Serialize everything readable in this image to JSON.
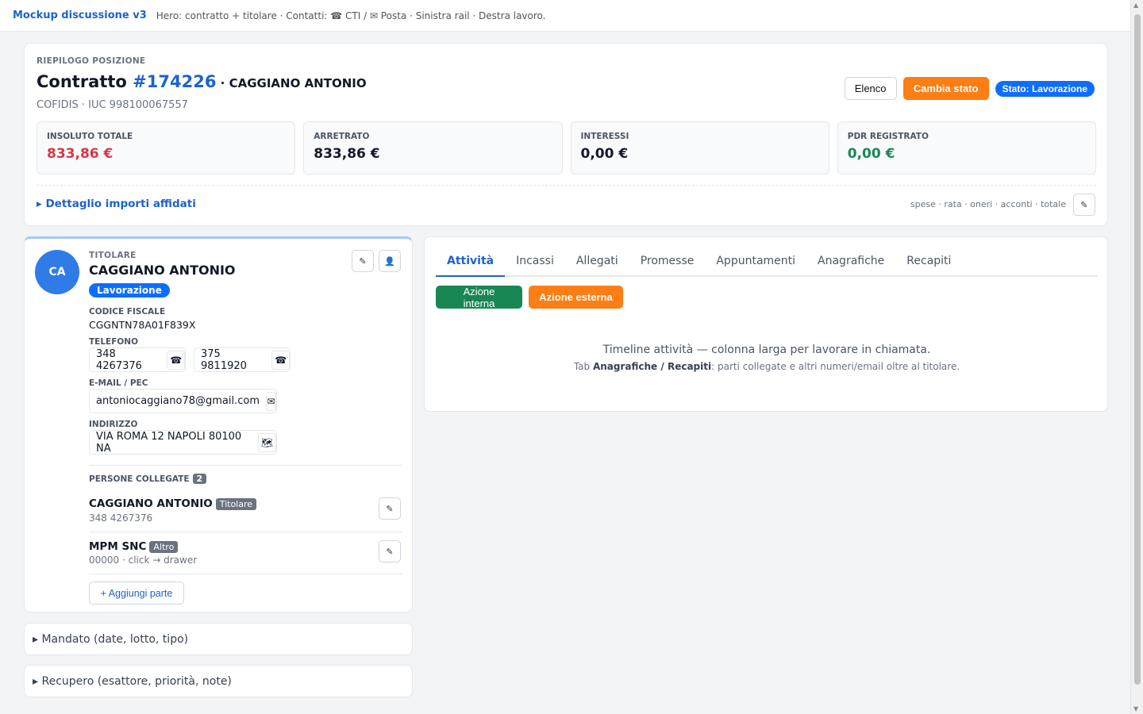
{
  "topbar": {
    "brand": "Mockup discussione v3",
    "subtitle": "Hero: contratto + titolare · Contatti: ☎ CTI / ✉ Posta · Sinistra rail · Destra lavoro."
  },
  "hero": {
    "eyebrow": "RIEPILOGO POSIZIONE",
    "title_prefix": "Contratto ",
    "contract_number": "#174226",
    "title_sep": " · ",
    "name": "CAGGIANO ANTONIO",
    "meta": "COFIDIS · IUC 998100067557",
    "actions": {
      "list_label": "Elenco",
      "change_state_label": "Cambia stato",
      "state_badge": "Stato: Lavorazione"
    },
    "stats": [
      {
        "label": "INSOLUTO TOTALE",
        "value": "833,86 €"
      },
      {
        "label": "ARRETRATO",
        "value": "833,86 €"
      },
      {
        "label": "INTERESSI",
        "value": "0,00 €"
      },
      {
        "label": "PDR REGISTRATO",
        "value": "0,00 €"
      }
    ],
    "detail_toggle": "▸ Dettaglio importi affidati",
    "detail_meta": "spese · rata · oneri · acconti · totale"
  },
  "owner": {
    "initials": "CA",
    "eyebrow": "TITOLARE",
    "name": "CAGGIANO ANTONIO",
    "status": "Lavorazione",
    "fiscal_code_label": "CODICE FISCALE",
    "fiscal_code": "CGGNTN78A01F839X",
    "phone_label": "TELEFONO",
    "phones": [
      "348 4267376",
      "375 9811920"
    ],
    "email_label": "E-MAIL / PEC",
    "email": "antoniocaggiano78@gmail.com",
    "address_label": "INDIRIZZO",
    "address": "VIA ROMA 12 NAPOLI 80100 NA",
    "linked_title": "PERSONE COLLEGATE",
    "linked_count": "2",
    "linked": [
      {
        "name": "CAGGIANO ANTONIO",
        "role": "Titolare",
        "sub": "348 4267376"
      },
      {
        "name": "MPM SNC",
        "role": "Altro",
        "sub": "00000 · click → drawer"
      }
    ],
    "add_label": "+ Aggiungi parte"
  },
  "accordions": [
    "▸ Mandato (date, lotto, tipo)",
    "▸ Recupero (esattore, priorità, note)"
  ],
  "panel": {
    "tabs": [
      "Attività",
      "Incassi",
      "Allegati",
      "Promesse",
      "Appuntamenti",
      "Anagrafiche",
      "Recapiti"
    ],
    "internal_action": "Azione interna",
    "external_action": "Azione esterna",
    "empty_main": "Timeline attività — colonna larga per lavorare in chiamata.",
    "empty_sub_prefix": "Tab ",
    "empty_sub_b1": "Anagrafiche",
    "empty_sub_mid": " / ",
    "empty_sub_b2": "Recapiti",
    "empty_sub_suffix": ": parti collegate e altri numeri/email oltre al titolare."
  },
  "colors": {
    "accent": "#1d63c9",
    "orange": "#fd7e14",
    "red": "#dc3545",
    "green": "#198754"
  }
}
